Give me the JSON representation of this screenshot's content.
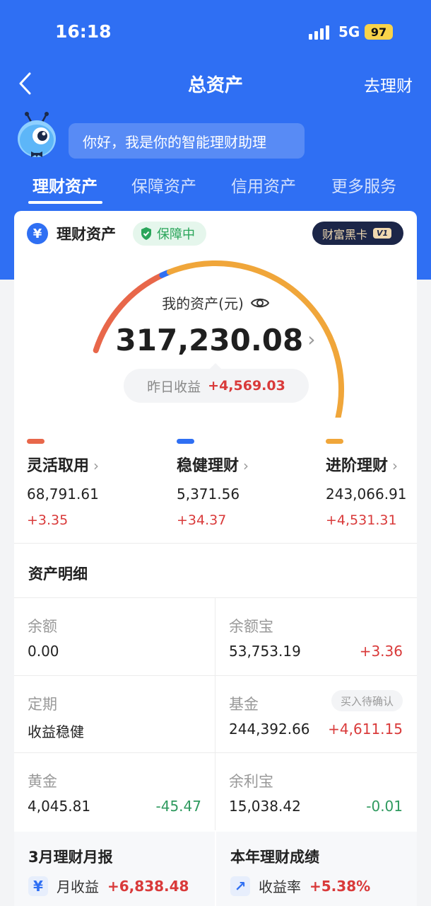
{
  "status": {
    "time": "16:18",
    "network": "5G",
    "battery": "97"
  },
  "nav": {
    "title": "总资产",
    "action": "去理财"
  },
  "assistant": {
    "greeting": "你好，我是你的智能理财助理"
  },
  "tabs": [
    {
      "label": "理财资产"
    },
    {
      "label": "保障资产"
    },
    {
      "label": "信用资产"
    },
    {
      "label": "更多服务"
    }
  ],
  "card": {
    "yen": "¥",
    "title": "理财资产",
    "protect": "保障中",
    "wealth_card": "财富黑卡",
    "wealth_level": "V1"
  },
  "summary": {
    "label": "我的资产(元)",
    "total": "317,230.08",
    "yesterday_label": "昨日收益",
    "yesterday_value": "+4,569.03"
  },
  "gauge": {
    "segments": [
      {
        "name": "灵活取用",
        "share": 0.217,
        "color": "#e8674a"
      },
      {
        "name": "稳健理财",
        "share": 0.017,
        "color": "#2f6ff3"
      },
      {
        "name": "进阶理财",
        "share": 0.766,
        "color": "#f0a63a"
      }
    ]
  },
  "categories": [
    {
      "name": "灵活取用",
      "value": "68,791.61",
      "change": "+3.35",
      "color": "#e8674a"
    },
    {
      "name": "稳健理财",
      "value": "5,371.56",
      "change": "+34.37",
      "color": "#2f6ff3"
    },
    {
      "name": "进阶理财",
      "value": "243,066.91",
      "change": "+4,531.31",
      "color": "#f0a63a"
    }
  ],
  "details": {
    "title": "资产明细",
    "items": [
      {
        "label": "余额",
        "value": "0.00",
        "delta": ""
      },
      {
        "label": "余额宝",
        "value": "53,753.19",
        "delta": "+3.36"
      },
      {
        "label": "定期",
        "value": "收益稳健",
        "delta": ""
      },
      {
        "label": "基金",
        "value": "244,392.66",
        "delta": "+4,611.15",
        "tag": "买入待确认"
      },
      {
        "label": "黄金",
        "value": "4,045.81",
        "delta": "-45.47"
      },
      {
        "label": "余利宝",
        "value": "15,038.42",
        "delta": "-0.01"
      }
    ]
  },
  "reports": [
    {
      "title": "3月理财月报",
      "icon": "¥",
      "key": "月收益",
      "value": "+6,838.48"
    },
    {
      "title": "本年理财成绩",
      "icon": "↗",
      "key": "收益率",
      "value": "+5.38%"
    }
  ]
}
